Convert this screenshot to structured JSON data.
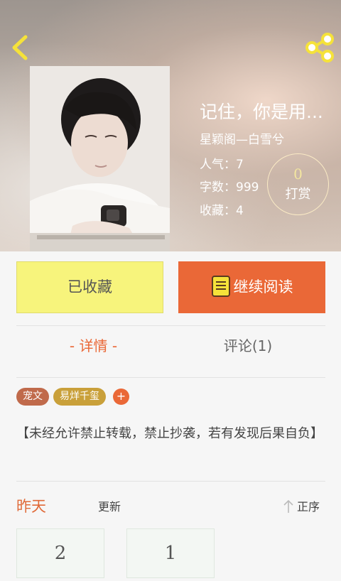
{
  "book": {
    "title": "记住，你是用...",
    "author": "星颖阁—白雪兮",
    "popularity": "人气：7",
    "word_count": "字数：999",
    "favorites": "收藏：4"
  },
  "tip": {
    "count": "0",
    "label": "打赏"
  },
  "actions": {
    "collected_label": "已收藏",
    "continue_label": "继续阅读"
  },
  "tabs": {
    "detail": "- 详情 -",
    "comments": "评论(1)"
  },
  "tags": [
    "宠文",
    "易烊千玺"
  ],
  "tag_add": "+",
  "description": "【未经允许禁止转载，禁止抄袭，若有发现后果自负】",
  "update": {
    "day": "昨天",
    "label": "更新",
    "sort": "正序"
  },
  "chapters": [
    "2",
    "1"
  ],
  "colors": {
    "accent": "#ea6837",
    "collected_bg": "#f7f47c",
    "icon_yellow": "#f5e23a"
  },
  "icons": {
    "back": "chevron-left-icon",
    "share": "share-icon",
    "book": "book-icon",
    "sort": "arrow-up-icon"
  }
}
